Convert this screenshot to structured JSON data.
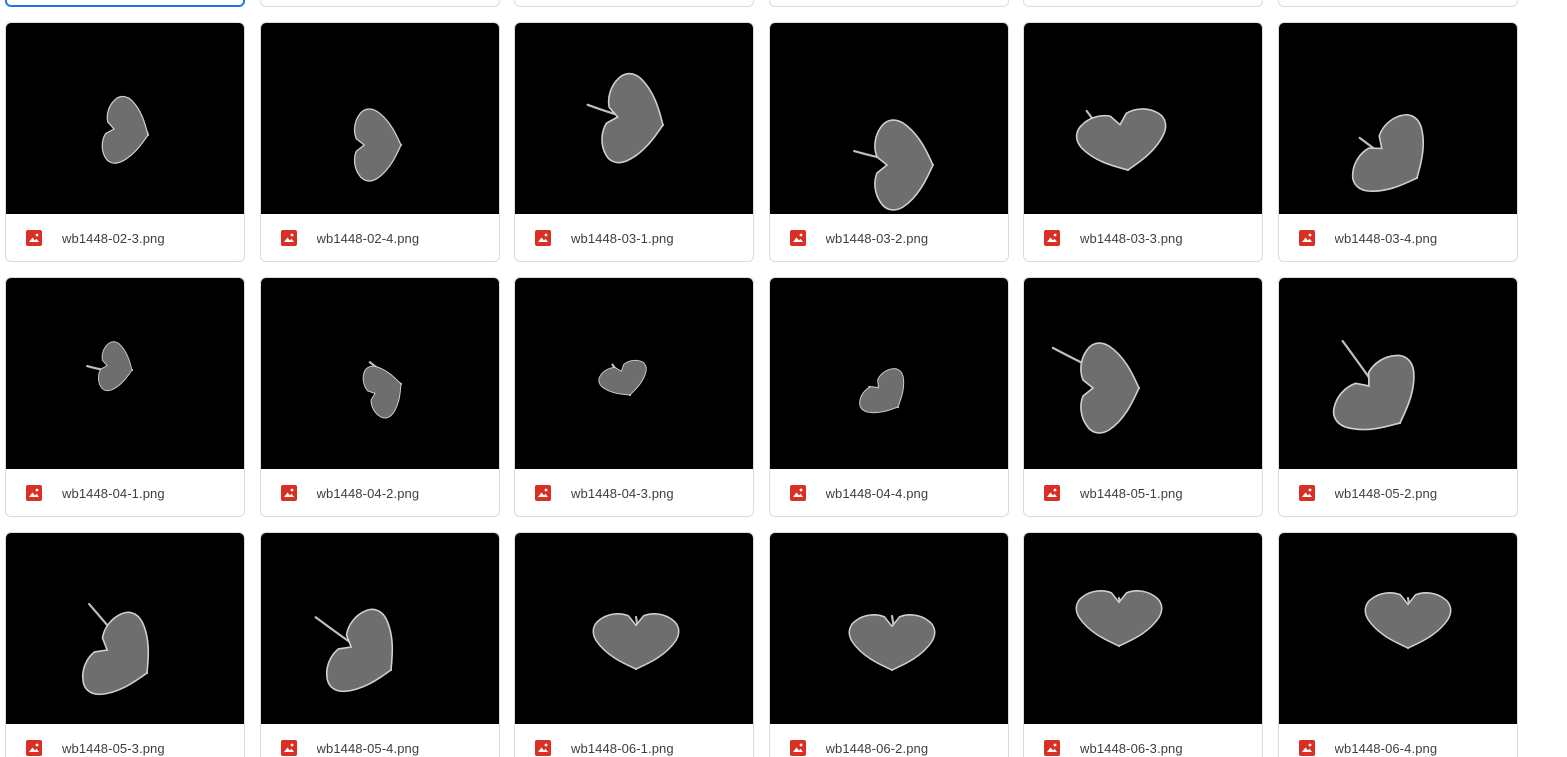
{
  "file_type_icon": "image-file-icon",
  "accent_color": "#d93025",
  "selection_color": "#1a73e8",
  "files": [
    {
      "name": "",
      "selected": true
    },
    {
      "name": ""
    },
    {
      "name": ""
    },
    {
      "name": ""
    },
    {
      "name": ""
    },
    {
      "name": ""
    },
    {
      "name": "wb1448-02-3.png"
    },
    {
      "name": "wb1448-02-4.png"
    },
    {
      "name": "wb1448-03-1.png"
    },
    {
      "name": "wb1448-03-2.png"
    },
    {
      "name": "wb1448-03-3.png"
    },
    {
      "name": "wb1448-03-4.png"
    },
    {
      "name": "wb1448-04-1.png"
    },
    {
      "name": "wb1448-04-2.png"
    },
    {
      "name": "wb1448-04-3.png"
    },
    {
      "name": "wb1448-04-4.png"
    },
    {
      "name": "wb1448-05-1.png"
    },
    {
      "name": "wb1448-05-2.png"
    },
    {
      "name": "wb1448-05-3.png"
    },
    {
      "name": "wb1448-05-4.png"
    },
    {
      "name": "wb1448-06-1.png"
    },
    {
      "name": "wb1448-06-2.png"
    },
    {
      "name": "wb1448-06-3.png"
    },
    {
      "name": "wb1448-06-4.png"
    }
  ]
}
